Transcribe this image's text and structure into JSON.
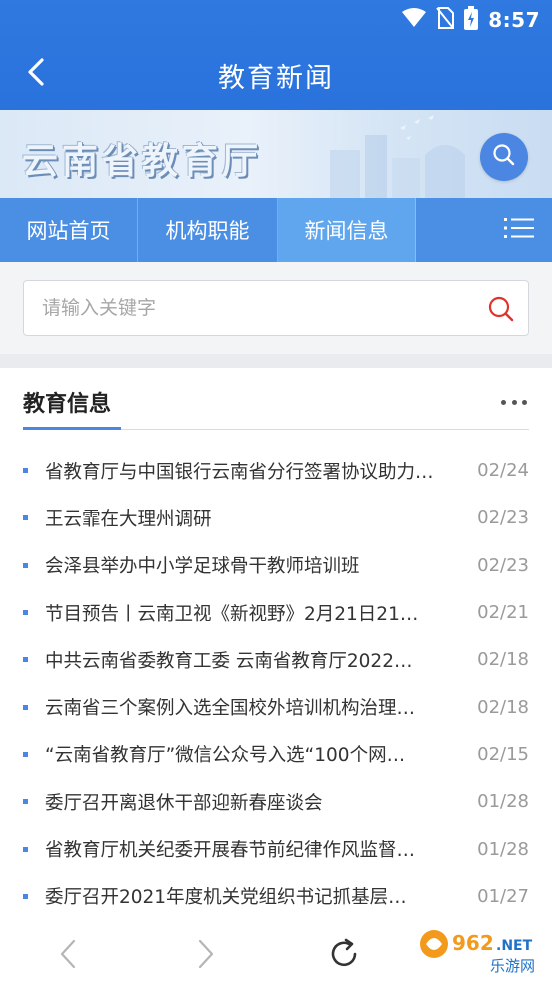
{
  "status_bar": {
    "time": "8:57"
  },
  "header": {
    "title": "教育新闻",
    "back_icon": "chevron-left-icon"
  },
  "banner": {
    "title": "云南省教育厅",
    "search_icon": "search-icon"
  },
  "nav": {
    "items": [
      {
        "label": "网站首页",
        "active": false
      },
      {
        "label": "机构职能",
        "active": false
      },
      {
        "label": "新闻信息",
        "active": true
      }
    ],
    "menu_icon": "list-menu-icon"
  },
  "search": {
    "placeholder": "请输入关键字",
    "value": ""
  },
  "section": {
    "title": "教育信息",
    "more_icon": "more-dots-icon"
  },
  "news": [
    {
      "title": "省教育厅与中国银行云南省分行签署协议助力…",
      "date": "02/24"
    },
    {
      "title": "王云霏在大理州调研",
      "date": "02/23"
    },
    {
      "title": "会泽县举办中小学足球骨干教师培训班",
      "date": "02/23"
    },
    {
      "title": "节目预告丨云南卫视《新视野》2月21日21…",
      "date": "02/21"
    },
    {
      "title": "中共云南省委教育工委 云南省教育厅2022…",
      "date": "02/18"
    },
    {
      "title": "云南省三个案例入选全国校外培训机构治理…",
      "date": "02/18"
    },
    {
      "title": "“云南省教育厅”微信公众号入选“100个网…",
      "date": "02/15"
    },
    {
      "title": "委厅召开离退休干部迎新春座谈会",
      "date": "01/28"
    },
    {
      "title": "省教育厅机关纪委开展春节前纪律作风监督…",
      "date": "01/28"
    },
    {
      "title": "委厅召开2021年度机关党组织书记抓基层…",
      "date": "01/27"
    }
  ],
  "watermark": {
    "line1": "962.NET",
    "line2": "乐游网"
  },
  "colors": {
    "primary": "#2f79e0",
    "nav": "#4b8fe4",
    "nav_active": "#5fa6ee",
    "accent": "#4a86e2",
    "search_red": "#e0332e"
  }
}
